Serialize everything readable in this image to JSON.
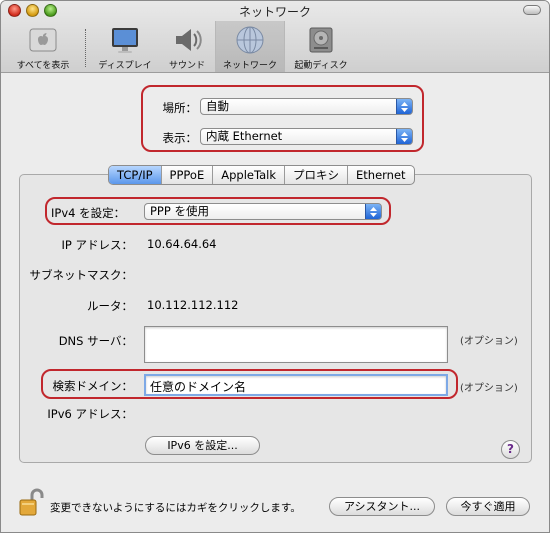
{
  "window": {
    "title": "ネットワーク"
  },
  "toolbar": {
    "items": [
      {
        "label": "すべてを表示"
      },
      {
        "label": "ディスプレイ"
      },
      {
        "label": "サウンド"
      },
      {
        "label": "ネットワーク",
        "selected": true
      },
      {
        "label": "起動ディスク"
      }
    ]
  },
  "location": {
    "label": "場所：",
    "value": "自動"
  },
  "show": {
    "label": "表示：",
    "value": "内蔵 Ethernet"
  },
  "tabs": [
    {
      "label": "TCP/IP",
      "active": true
    },
    {
      "label": "PPPoE"
    },
    {
      "label": "AppleTalk"
    },
    {
      "label": "プロキシ"
    },
    {
      "label": "Ethernet"
    }
  ],
  "tcpip": {
    "configure_label": "IPv4 を設定：",
    "configure_value": "PPP を使用",
    "ip_label": "IP アドレス：",
    "ip_value": "10.64.64.64",
    "subnet_label": "サブネットマスク：",
    "subnet_value": "",
    "router_label": "ルータ：",
    "router_value": "10.112.112.112",
    "dns_label": "DNS サーバ：",
    "dns_value": "",
    "dns_hint": "(オプション)",
    "search_label": "検索ドメイン：",
    "search_value": "任意のドメイン名",
    "search_hint": "(オプション)",
    "ipv6_label": "IPv6 アドレス：",
    "ipv6_button": "IPv6 を設定..."
  },
  "help": {
    "label": "?"
  },
  "footer": {
    "lock_text": "変更できないようにするにはカギをクリックします。",
    "assistant_button": "アシスタント...",
    "apply_button": "今すぐ適用"
  },
  "colors": {
    "highlight": "#c1272d",
    "accent": "#1f64d6"
  }
}
